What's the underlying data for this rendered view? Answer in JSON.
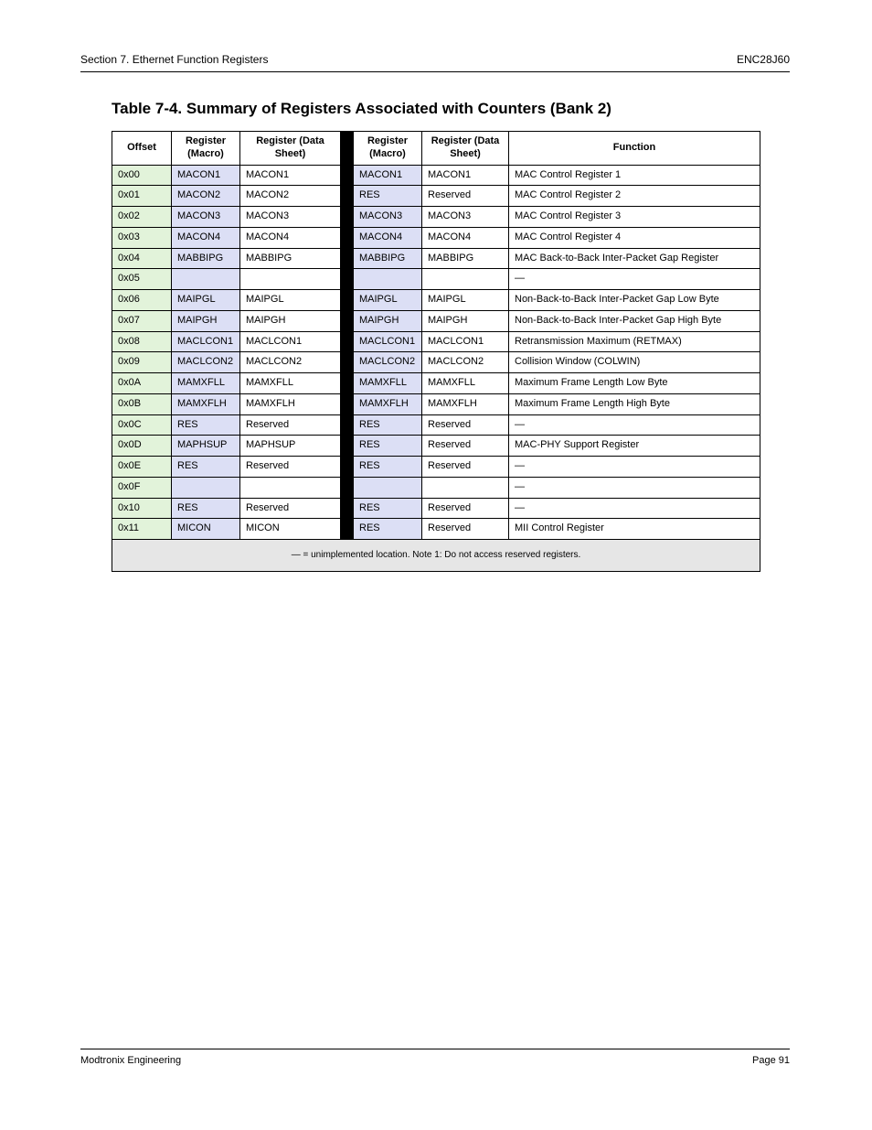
{
  "header": {
    "left": "Section 7.  Ethernet Function Registers",
    "right": "ENC28J60"
  },
  "section_title": "Table 7-4.  Summary of Registers Associated with Counters (Bank 2)",
  "table": {
    "headers": [
      "Offset",
      "Register (Macro)",
      "Register (Data Sheet)",
      "Register (Macro)",
      "Register (Data Sheet)",
      "Function"
    ],
    "rows": [
      {
        "off": "0x00",
        "m1": "MACON1",
        "d1": "MACON1",
        "m2": "MACON1",
        "d2": "MACON1",
        "fn": "MAC Control Register 1"
      },
      {
        "off": "0x01",
        "m1": "MACON2",
        "d1": "MACON2",
        "m2": "RES",
        "d2": "Reserved",
        "fn": "MAC Control Register 2"
      },
      {
        "off": "0x02",
        "m1": "MACON3",
        "d1": "MACON3",
        "m2": "MACON3",
        "d2": "MACON3",
        "fn": "MAC Control Register 3"
      },
      {
        "off": "0x03",
        "m1": "MACON4",
        "d1": "MACON4",
        "m2": "MACON4",
        "d2": "MACON4",
        "fn": "MAC Control Register 4"
      },
      {
        "off": "0x04",
        "m1": "MABBIPG",
        "d1": "MABBIPG",
        "m2": "MABBIPG",
        "d2": "MABBIPG",
        "fn": "MAC Back-to-Back Inter-Packet Gap Register"
      },
      {
        "off": "0x05",
        "m1": "",
        "d1": "",
        "m2": "",
        "d2": "",
        "fn": "—"
      },
      {
        "off": "0x06",
        "m1": "MAIPGL",
        "d1": "MAIPGL",
        "m2": "MAIPGL",
        "d2": "MAIPGL",
        "fn": "Non-Back-to-Back Inter-Packet Gap Low Byte"
      },
      {
        "off": "0x07",
        "m1": "MAIPGH",
        "d1": "MAIPGH",
        "m2": "MAIPGH",
        "d2": "MAIPGH",
        "fn": "Non-Back-to-Back Inter-Packet Gap High Byte",
        "noborderbottom": true
      },
      {
        "off": "0x08",
        "m1": "MACLCON1",
        "d1": "MACLCON1",
        "m2": "MACLCON1",
        "d2": "MACLCON1",
        "fn": "Retransmission Maximum (RETMAX)"
      },
      {
        "off": "0x09",
        "m1": "MACLCON2",
        "d1": "MACLCON2",
        "m2": "MACLCON2",
        "d2": "MACLCON2",
        "fn": "Collision Window (COLWIN)"
      },
      {
        "off": "0x0A",
        "m1": "MAMXFLL",
        "d1": "MAMXFLL",
        "m2": "MAMXFLL",
        "d2": "MAMXFLL",
        "fn": "Maximum Frame Length Low Byte"
      },
      {
        "off": "0x0B",
        "m1": "MAMXFLH",
        "d1": "MAMXFLH",
        "m2": "MAMXFLH",
        "d2": "MAMXFLH",
        "fn": "Maximum Frame Length High Byte"
      },
      {
        "off": "0x0C",
        "m1": "RES",
        "d1": "Reserved",
        "m2": "RES",
        "d2": "Reserved",
        "fn": "—"
      },
      {
        "off": "0x0D",
        "m1": "MAPHSUP",
        "d1": "MAPHSUP",
        "m2": "RES",
        "d2": "Reserved",
        "fn": "MAC-PHY Support Register"
      },
      {
        "off": "0x0E",
        "m1": "RES",
        "d1": "Reserved",
        "m2": "RES",
        "d2": "Reserved",
        "fn": "—"
      },
      {
        "off": "0x0F",
        "m1": "",
        "d1": "",
        "m2": "",
        "d2": "",
        "fn": "—"
      },
      {
        "off": "0x10",
        "m1": "RES",
        "d1": "Reserved",
        "m2": "RES",
        "d2": "Reserved",
        "fn": "—"
      },
      {
        "off": "0x11",
        "m1": "MICON",
        "d1": "MICON",
        "m2": "RES",
        "d2": "Reserved",
        "fn": "MII Control Register"
      }
    ],
    "footer": "— = unimplemented location.  Note 1:  Do not access reserved registers."
  },
  "footer": {
    "left": "Modtronix Engineering",
    "right": "Page 91"
  }
}
